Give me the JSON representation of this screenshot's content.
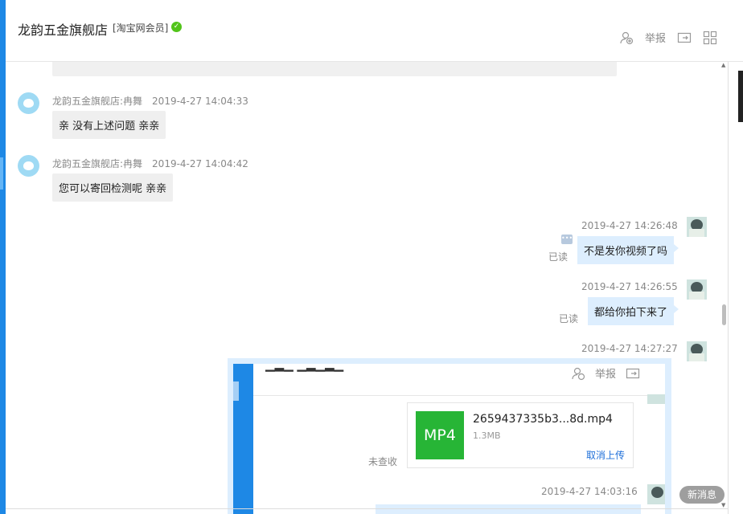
{
  "header": {
    "shop_name": "龙韵五金旗舰店",
    "member_tag": "[淘宝网会员]",
    "report_label": "举报",
    "icons": [
      "person-add-icon",
      "report-label",
      "folder-arrow-icon",
      "grid-icon"
    ]
  },
  "cut_message": "",
  "messages": [
    {
      "sender": "龙韵五金旗舰店:冉舞",
      "time": "2019-4-27 14:04:33",
      "text": "亲 没有上述问题 亲亲"
    },
    {
      "sender": "龙韵五金旗舰店:冉舞",
      "time": "2019-4-27 14:04:42",
      "text": "您可以寄回检测呢 亲亲"
    },
    {
      "time": "2019-4-27 14:26:48",
      "text": "不是发你视频了吗",
      "status": "已读"
    },
    {
      "time": "2019-4-27 14:26:55",
      "text": "都给你拍下来了",
      "status": "已读"
    },
    {
      "time": "2019-4-27 14:27:27"
    }
  ],
  "embedded": {
    "report_label": "举报",
    "file_type": "MP4",
    "file_name": "2659437335b3...8d.mp4",
    "file_size": "1.3MB",
    "cancel_upload": "取消上传",
    "status": "未查收",
    "time": "2019-4-27 14:03:16"
  },
  "new_message_button": "新消息",
  "colors": {
    "accent": "#1e88e5",
    "bubble_in": "#efefef",
    "bubble_out": "#ddeefe",
    "verified": "#52c41a",
    "mp4": "#27b536",
    "link": "#1e6fd9"
  }
}
